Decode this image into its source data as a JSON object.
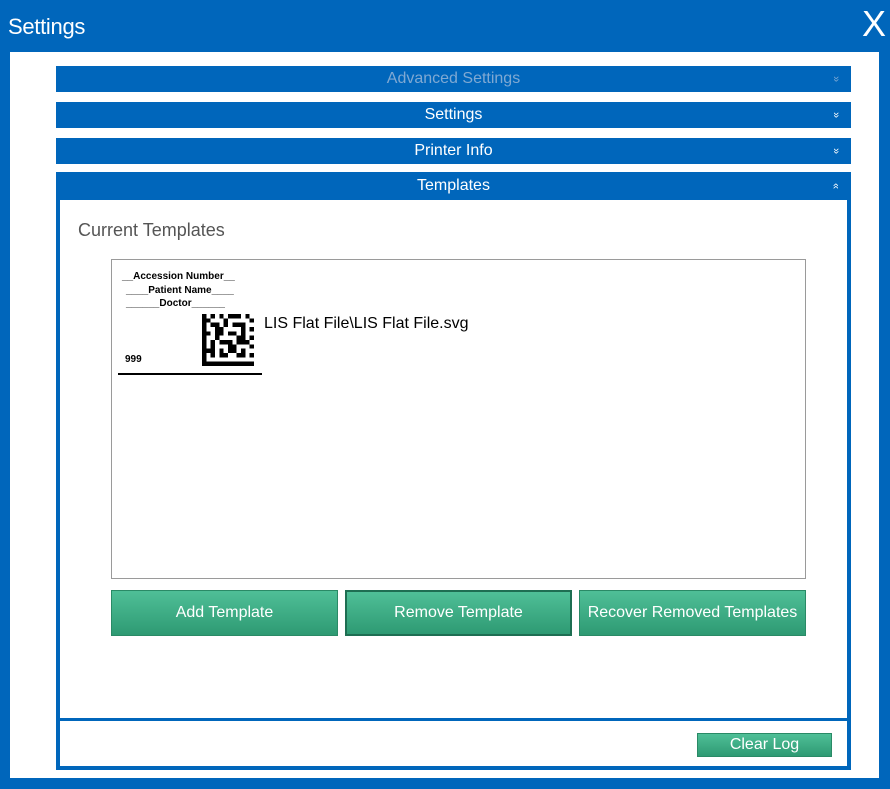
{
  "window": {
    "title": "Settings",
    "close_label": "X"
  },
  "accordion": [
    {
      "label": "Advanced Settings",
      "chevron": "»",
      "state": "disabled"
    },
    {
      "label": "Settings",
      "chevron": "»",
      "state": "collapsed"
    },
    {
      "label": "Printer Info",
      "chevron": "»",
      "state": "collapsed"
    },
    {
      "label": "Templates",
      "chevron": "»",
      "state": "expanded"
    }
  ],
  "templates_section": {
    "title": "Current Templates",
    "items": [
      {
        "thumbnail_lines": [
          "__Accession Number__",
          "____Patient Name____",
          "______Doctor______"
        ],
        "thumbnail_number": "999",
        "name": "LIS Flat File\\LIS Flat File.svg"
      }
    ]
  },
  "buttons": {
    "add": "Add Template",
    "remove": "Remove Template",
    "recover": "Recover Removed Templates",
    "clear_log": "Clear Log"
  },
  "colors": {
    "primary": "#0066bb",
    "button": "#3aa882",
    "dim_text": "#7fa9d3"
  },
  "icons": {
    "close": "close-icon",
    "chevron": "chevron-icon",
    "barcode": "datamatrix-icon"
  }
}
